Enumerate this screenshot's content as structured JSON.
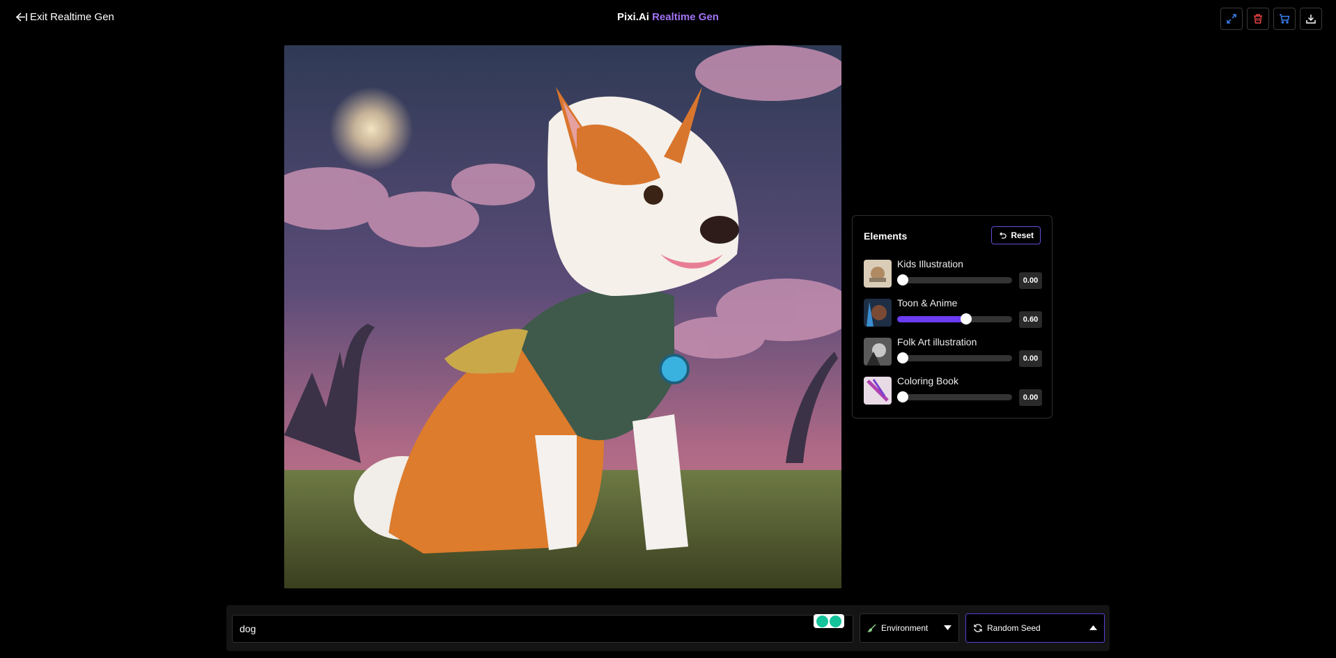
{
  "header": {
    "exit_label": "Exit Realtime Gen",
    "brand_name": "Pixi.Ai",
    "brand_product": "Realtime Gen",
    "accent_color": "#a273f5",
    "actions": [
      {
        "icon": "expand-icon",
        "color": "#3b82f6"
      },
      {
        "icon": "trash-icon",
        "color": "#ef4444"
      },
      {
        "icon": "cart-icon",
        "color": "#3b82f6"
      },
      {
        "icon": "download-icon",
        "color": "#ffffff"
      }
    ]
  },
  "elements_panel": {
    "title": "Elements",
    "reset_label": "Reset",
    "items": [
      {
        "name": "Kids Illustration",
        "value": 0.0,
        "value_label": "0.00"
      },
      {
        "name": "Toon & Anime",
        "value": 0.6,
        "value_label": "0.60"
      },
      {
        "name": "Folk Art illustration",
        "value": 0.0,
        "value_label": "0.00"
      },
      {
        "name": "Coloring Book",
        "value": 0.0,
        "value_label": "0.00"
      }
    ],
    "slider_color": "#6b3cf2"
  },
  "bottom_bar": {
    "prompt_value": "dog",
    "environment_label": "Environment",
    "seed_label": "Random Seed"
  }
}
